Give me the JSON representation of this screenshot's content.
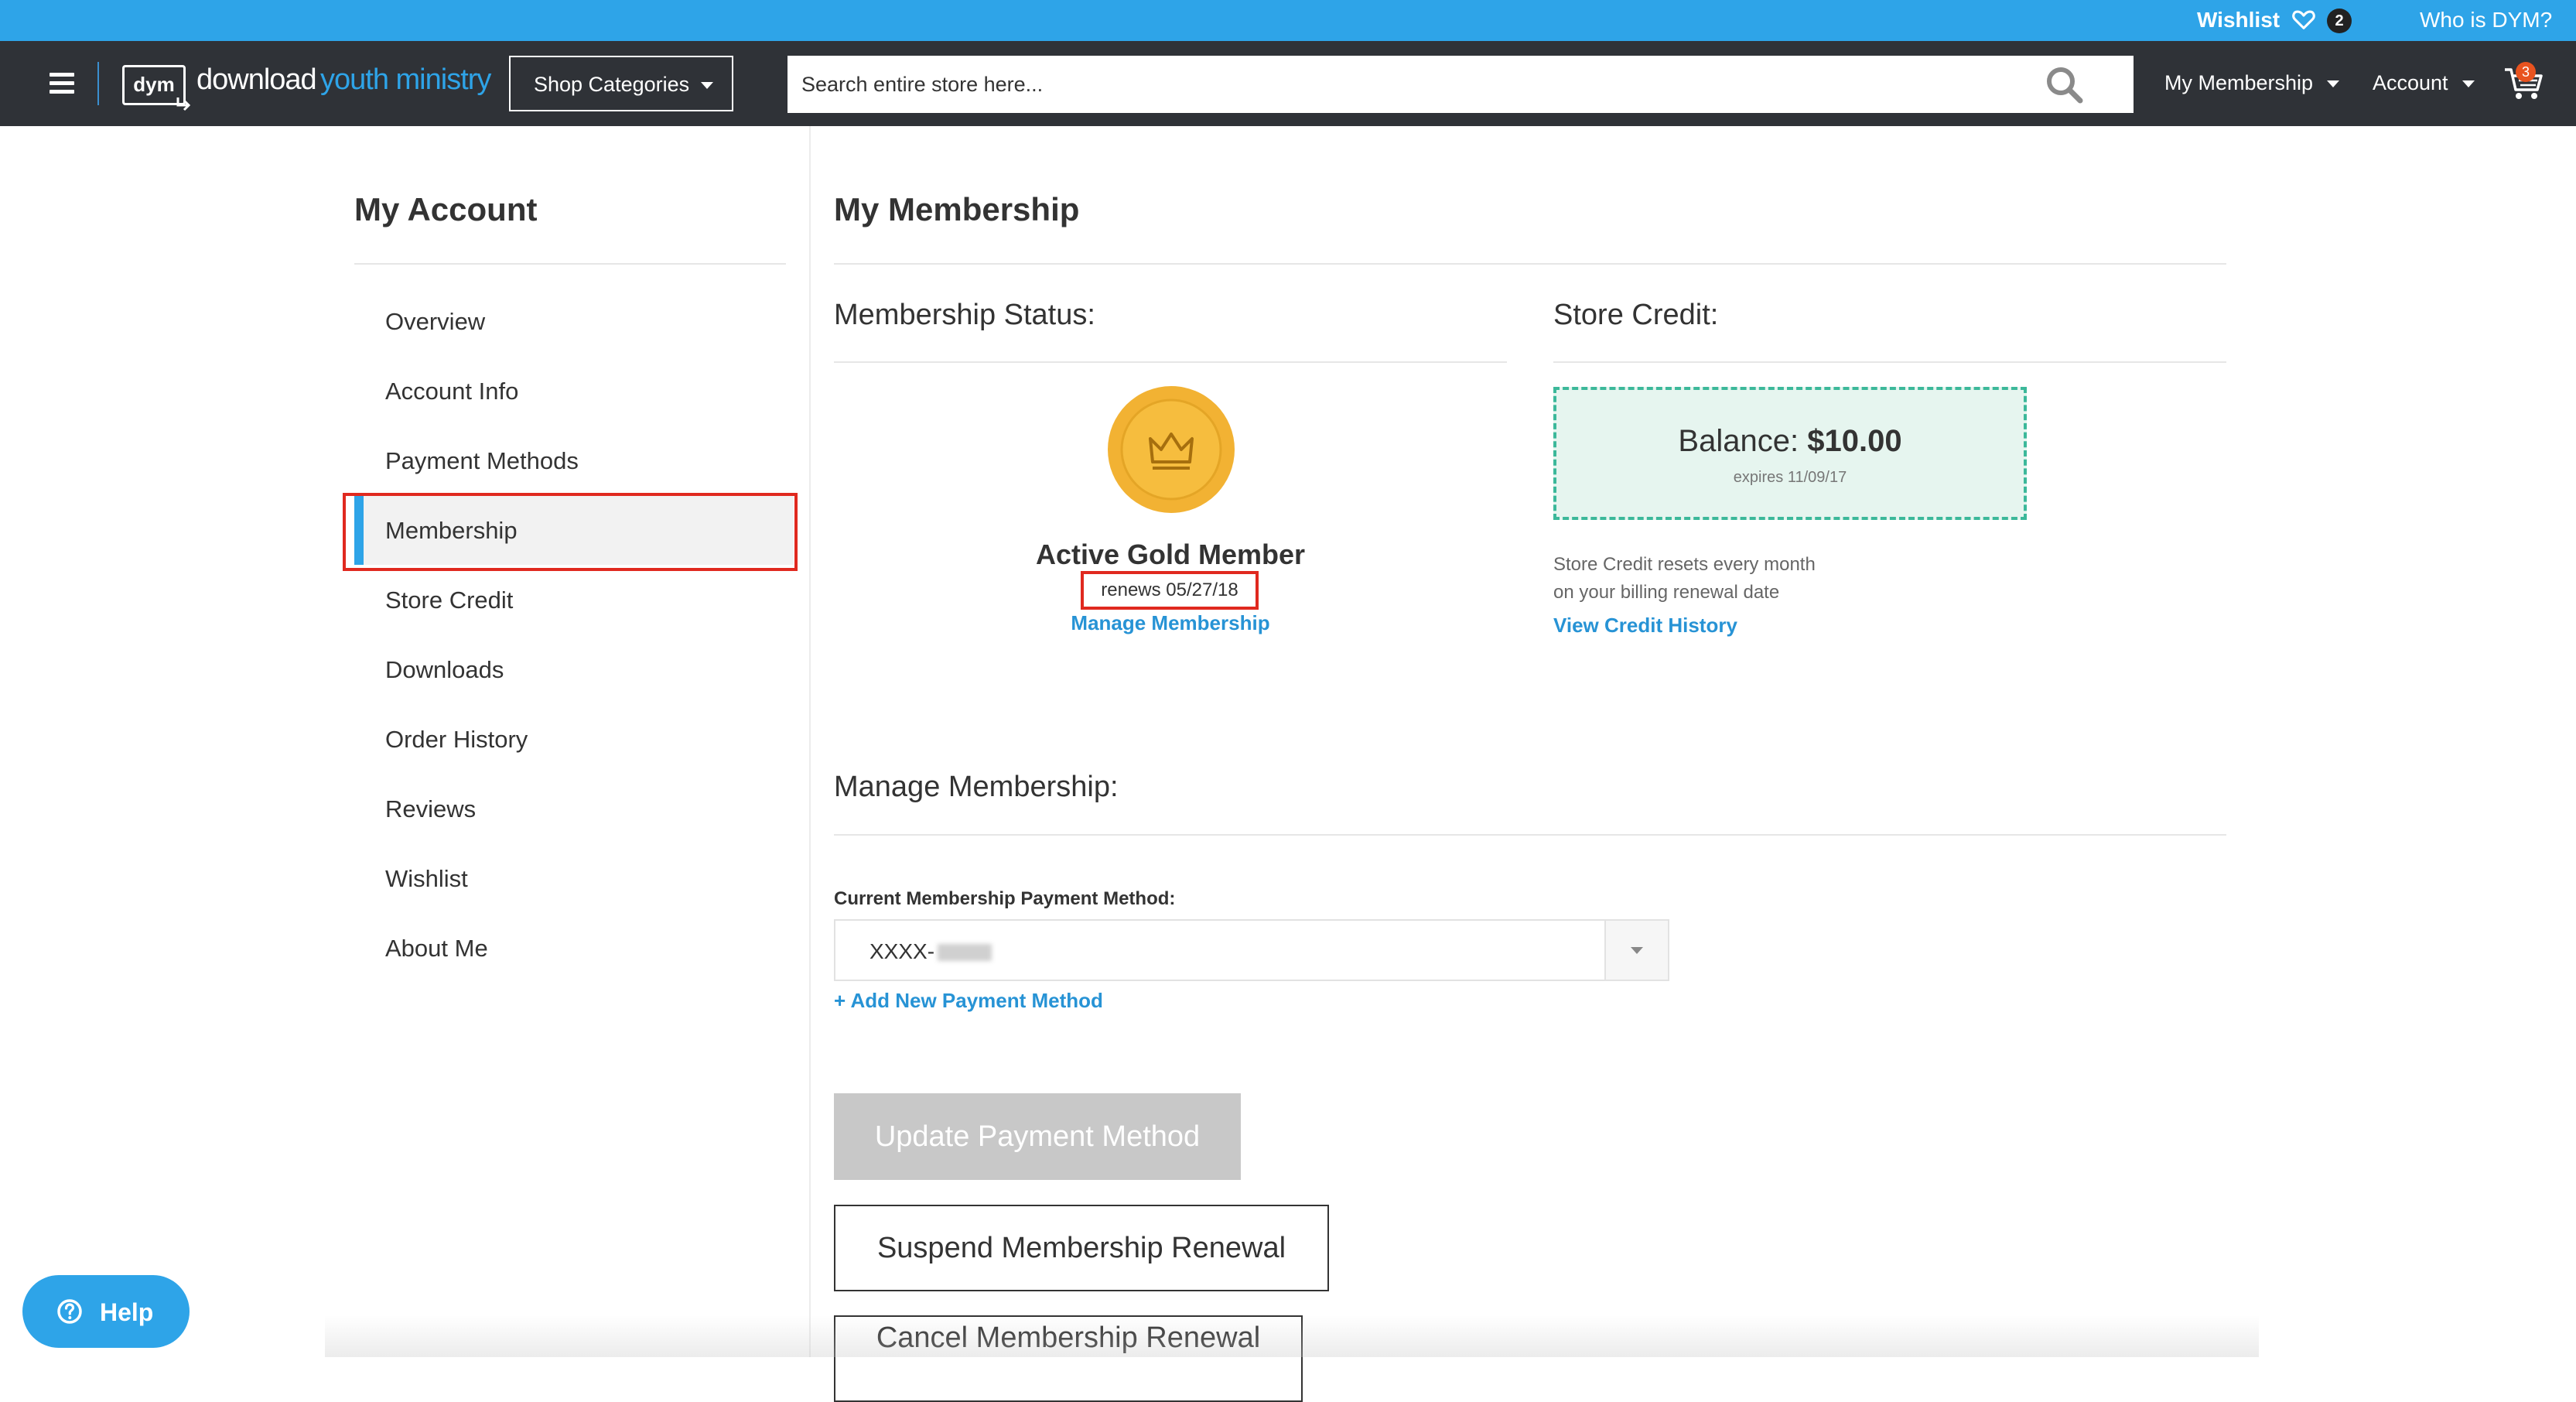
{
  "topbar": {
    "wishlist_label": "Wishlist",
    "wishlist_count": "2",
    "who_link": "Who is DYM?",
    "heart_icon": "heart-icon"
  },
  "header": {
    "logo_mark": "dym",
    "logo_word1": "download",
    "logo_word2": "youth ministry",
    "shop_categories": "Shop Categories",
    "search_placeholder": "Search entire store here...",
    "my_membership": "My Membership",
    "account": "Account",
    "cart_count": "3",
    "icons": [
      "menu-icon",
      "search-icon",
      "cart-icon",
      "chevron-down-icon"
    ]
  },
  "sidebar": {
    "title": "My Account",
    "active_index": 3,
    "items": [
      {
        "label": "Overview"
      },
      {
        "label": "Account Info"
      },
      {
        "label": "Payment Methods"
      },
      {
        "label": "Membership"
      },
      {
        "label": "Store Credit"
      },
      {
        "label": "Downloads"
      },
      {
        "label": "Order History"
      },
      {
        "label": "Reviews"
      },
      {
        "label": "Wishlist"
      },
      {
        "label": "About Me"
      }
    ]
  },
  "main": {
    "title": "My Membership",
    "membership_status": {
      "heading": "Membership Status:",
      "status": "Active Gold Member",
      "renews": "renews 05/27/18",
      "manage_link": "Manage Membership",
      "medal_icon": "crown-medal-icon"
    },
    "store_credit": {
      "heading": "Store Credit:",
      "balance_label": "Balance:",
      "balance_value": "$10.00",
      "expires": "expires 11/09/17",
      "note_line1": "Store Credit resets every month",
      "note_line2": "on your billing renewal date",
      "history_link": "View Credit History"
    },
    "manage": {
      "heading": "Manage Membership:",
      "payment_label": "Current Membership Payment Method:",
      "payment_value": "XXXX-",
      "add_payment": "+ Add New Payment Method",
      "update_button": "Update Payment Method",
      "suspend_button": "Suspend Membership Renewal",
      "cancel_button": "Cancel Membership Renewal"
    }
  },
  "help": {
    "label": "Help"
  },
  "colors": {
    "accent": "#2ea4e8",
    "header_bg": "#2f3237",
    "highlight_red": "#e0291f",
    "gold": "#f2b233",
    "credit_green": "#3cb89a"
  }
}
